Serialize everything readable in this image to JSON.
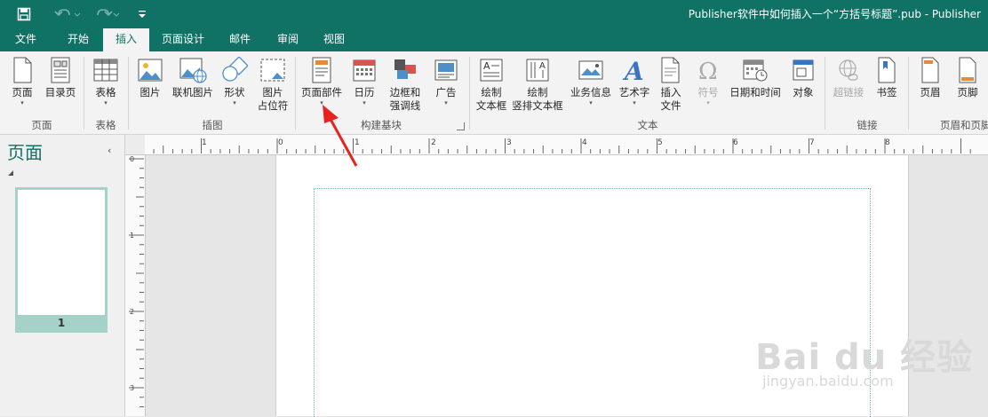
{
  "titlebar": {
    "title": "Publisher软件中如何插入一个“方括号标题”.pub - Publisher",
    "quick_access": [
      "save-icon",
      "undo-icon",
      "redo-icon",
      "customize-icon"
    ]
  },
  "tabs": [
    {
      "label": "文件",
      "active": false
    },
    {
      "label": "开始",
      "active": false
    },
    {
      "label": "插入",
      "active": true
    },
    {
      "label": "页面设计",
      "active": false
    },
    {
      "label": "邮件",
      "active": false
    },
    {
      "label": "审阅",
      "active": false
    },
    {
      "label": "视图",
      "active": false
    }
  ],
  "ribbon": {
    "groups": {
      "pages": "页面",
      "tables": "表格",
      "illustrations": "插图",
      "building_blocks": "构建基块",
      "text": "文本",
      "links": "链接",
      "header_footer": "页眉和页脚"
    },
    "buttons": {
      "page": "页面",
      "catalog_page": "目录页",
      "table": "表格",
      "picture": "图片",
      "online_picture": "联机图片",
      "shapes": "形状",
      "picture_placeholder_1": "图片",
      "picture_placeholder_2": "占位符",
      "page_parts": "页面部件",
      "calendars": "日历",
      "borders_1": "边框和",
      "borders_2": "强调线",
      "advertisements": "广告",
      "draw_textbox_1": "绘制",
      "draw_textbox_2": "文本框",
      "draw_vtextbox_1": "绘制",
      "draw_vtextbox_2": "竖排文本框",
      "business_info": "业务信息",
      "wordart": "艺术字",
      "insert_file_1": "插入",
      "insert_file_2": "文件",
      "symbol": "符号",
      "date_time": "日期和时间",
      "object": "对象",
      "hyperlink": "超链接",
      "bookmark": "书签",
      "header": "页眉",
      "footer": "页脚"
    },
    "dropdown_glyph": "▾"
  },
  "pages_pane": {
    "title": "页面",
    "collapse_glyph": "‹",
    "thumbnails": [
      {
        "number": "1"
      }
    ]
  },
  "rulers": {
    "horizontal_labels": [
      "1",
      "0",
      "1",
      "2",
      "3",
      "4",
      "5",
      "6",
      "7",
      "8"
    ],
    "vertical_labels": [
      "0",
      "1",
      "2",
      "3"
    ]
  },
  "watermark": {
    "text": "Bai du 经验",
    "sub": "jingyan.baidu.com"
  },
  "colors": {
    "accent": "#0f7265",
    "annotation": "#e8231f",
    "guide": "#6ab8b0"
  }
}
